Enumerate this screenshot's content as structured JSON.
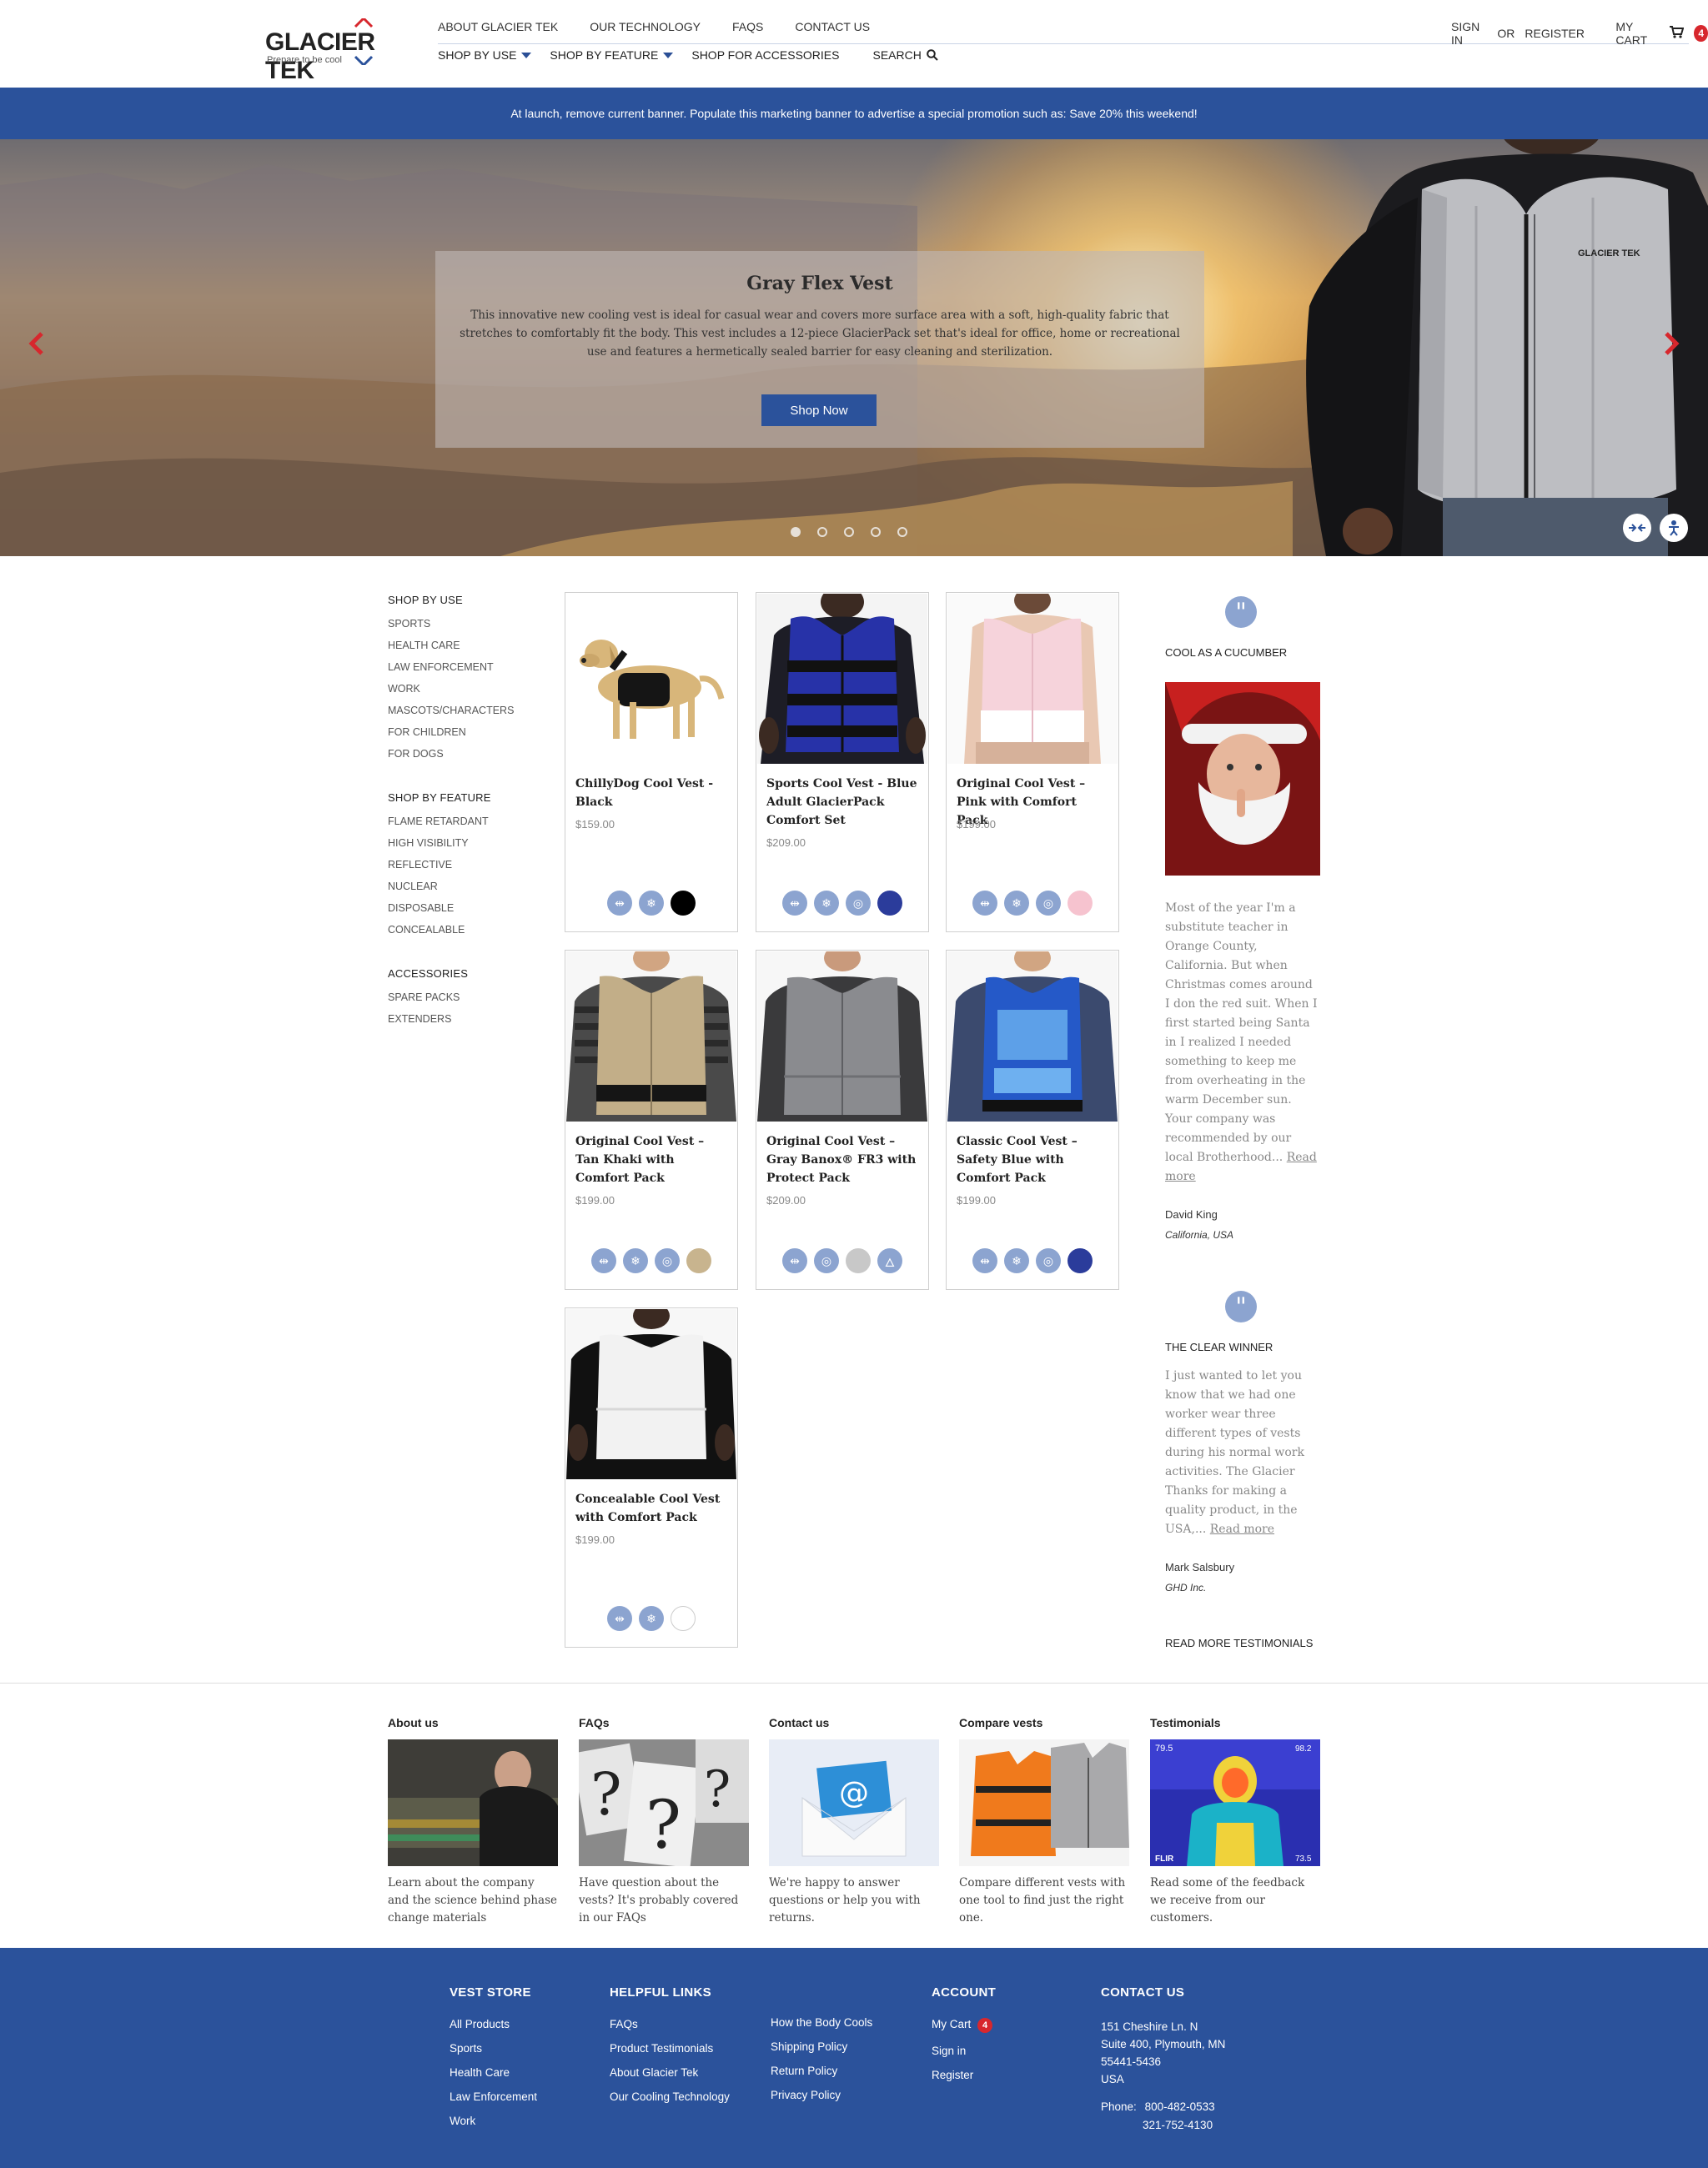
{
  "brand": {
    "name": "GLACIER TEK",
    "tagline": "Prepare to be cool"
  },
  "topnav": {
    "about": "ABOUT GLACIER TEK",
    "technology": "OUR TECHNOLOGY",
    "faqs": "FAQS",
    "contact": "CONTACT US"
  },
  "account": {
    "sign_in": "SIGN IN",
    "or": "OR",
    "register": "REGISTER",
    "cart": "MY CART",
    "cart_count": "4"
  },
  "subnav": {
    "use": "SHOP BY USE",
    "feature": "SHOP BY FEATURE",
    "accessories": "SHOP FOR ACCESSORIES",
    "search": "SEARCH"
  },
  "promo": "At launch, remove current banner. Populate this marketing banner to advertise a special promotion such as: Save 20% this weekend!",
  "hero": {
    "title": "Gray Flex Vest",
    "text": "This innovative new cooling vest is ideal for casual wear and covers more surface area with a soft, high-quality fabric that stretches to comfortably fit the body. This vest includes a 12-piece GlacierPack set that's ideal for office, home or recreational use and features a hermetically sealed barrier for easy cleaning and sterilization.",
    "button": "Shop Now",
    "vest_logo": "GLACIER TEK"
  },
  "sidebar": {
    "use_title": "SHOP BY USE",
    "use": [
      "SPORTS",
      "HEALTH CARE",
      "LAW ENFORCEMENT",
      "WORK",
      "MASCOTS/CHARACTERS",
      "FOR CHILDREN",
      "FOR DOGS"
    ],
    "feature_title": "SHOP BY FEATURE",
    "feature": [
      "FLAME RETARDANT",
      "HIGH VISIBILITY",
      "REFLECTIVE",
      "NUCLEAR",
      "DISPOSABLE",
      "CONCEALABLE"
    ],
    "acc_title": "ACCESSORIES",
    "acc": [
      "SPARE PACKS",
      "EXTENDERS"
    ]
  },
  "products": [
    {
      "name": "ChillyDog Cool Vest - Black",
      "price": "$159.00",
      "color": "#000000"
    },
    {
      "name": "Sports Cool Vest - Blue Adult GlacierPack Comfort Set",
      "price": "$209.00",
      "color": "#2b3c9b"
    },
    {
      "name": "Original Cool Vest – Pink with Comfort Pack",
      "price": "$199.00",
      "color": "#f6c3cf"
    },
    {
      "name": "Original Cool Vest – Tan Khaki with Comfort Pack",
      "price": "$199.00",
      "color": "#c8b48e"
    },
    {
      "name": "Original Cool Vest – Gray Banox® FR3 with Protect Pack",
      "price": "$209.00",
      "color": "#c8c8c8"
    },
    {
      "name": "Classic Cool Vest – Safety Blue with Comfort Pack",
      "price": "$199.00",
      "color": "#2b3c9b"
    },
    {
      "name": "Concealable Cool Vest with Comfort Pack",
      "price": "$199.00",
      "color": "#ffffff"
    }
  ],
  "testimonials": [
    {
      "title": "COOL AS A CUCUMBER",
      "body": "Most of the year I'm a substitute teacher in Orange County, California. But when Christmas comes around I don the red suit. When I first started being Santa in I realized I needed something to keep me from overheating in the warm December sun. Your company was recommended by our local Brotherhood...",
      "link": "Read more",
      "name": "David King",
      "location": "California, USA"
    },
    {
      "title": "THE CLEAR WINNER",
      "body": "I just wanted to let you know that we had one worker wear three different types of vests during his normal work activities. The Glacier Thanks for making a quality product, in the USA,...",
      "link": "Read more",
      "name": "Mark Salsbury",
      "location": "GHD Inc."
    }
  ],
  "more_testimonials": "READ MORE TESTIMONIALS",
  "footer_cards": [
    {
      "title": "About us",
      "text": "Learn about the company and the science behind phase change materials"
    },
    {
      "title": "FAQs",
      "text": "Have question about the vests? It's probably covered in our FAQs"
    },
    {
      "title": "Contact us",
      "text": "We're happy to answer questions or help you with returns."
    },
    {
      "title": "Compare vests",
      "text": "Compare different vests with one tool to find just the right one."
    },
    {
      "title": "Testimonials",
      "text": "Read some of the feedback we receive from our customers.",
      "thermal_readouts": [
        "79.5",
        "98.2",
        "73.5"
      ],
      "thermal_brand": "FLIR"
    }
  ],
  "footer": {
    "vest_store": {
      "title": "VEST STORE",
      "links": [
        "All Products",
        "Sports",
        "Health Care",
        "Law Enforcement",
        "Work"
      ]
    },
    "helpful": {
      "title": "HELPFUL LINKS",
      "links": [
        "FAQs",
        "Product Testimonials",
        "About Glacier Tek",
        "Our Cooling Technology"
      ],
      "links2": [
        "How the Body Cools",
        "Shipping Policy",
        "Return Policy",
        "Privacy Policy"
      ]
    },
    "account": {
      "title": "ACCOUNT",
      "cart": "My Cart",
      "cart_count": "4",
      "sign_in": "Sign in",
      "register": "Register"
    },
    "contact": {
      "title": "CONTACT US",
      "address": [
        "151 Cheshire Ln. N",
        "Suite 400, Plymouth, MN",
        "55441-5436",
        "USA"
      ],
      "phone_label": "Phone:",
      "phone1": "800-482-0533",
      "phone2": "321-752-4130"
    }
  },
  "colors": {
    "brand_blue": "#2b529b",
    "accent_red": "#d7272d",
    "icon_blue": "#8ca4d0"
  }
}
